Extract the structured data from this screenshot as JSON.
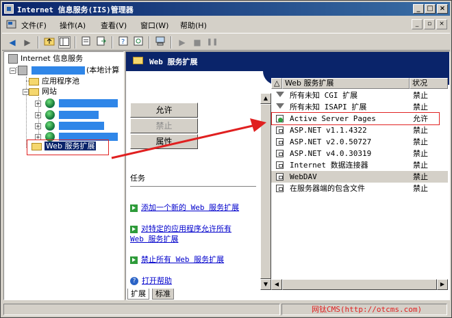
{
  "window": {
    "title": "Internet 信息服务(IIS)管理器",
    "minimize": "_",
    "maximize": "□",
    "close": "×"
  },
  "menu": {
    "items": [
      "文件(F)",
      "操作(A)",
      "查看(V)",
      "窗口(W)",
      "帮助(H)"
    ],
    "mdi": [
      "_",
      "▫",
      "×"
    ]
  },
  "toolbar": {
    "icons": [
      "back-icon",
      "forward-icon",
      "up-folder-icon",
      "show-tree-icon",
      "properties-icon",
      "export-icon",
      "help-icon",
      "refresh-icon",
      "computer-icon",
      "play-icon",
      "stop-icon",
      "pause-icon"
    ]
  },
  "tree": {
    "root": "Internet 信息服务",
    "computer_suffix": "(本地计算",
    "app_pools": "应用程序池",
    "sites": "网站",
    "site_fragment": "",
    "web_ext": "Web 服务扩展"
  },
  "header": {
    "title": "Web 服务扩展"
  },
  "buttons": {
    "allow": "允许",
    "deny": "禁止",
    "properties": "属性"
  },
  "tasks": {
    "label": "任务",
    "add_new": "添加一个新的 Web 服务扩展",
    "allow_all_line1": "对特定的应用程序允许所有",
    "allow_all_line2": "Web 服务扩展",
    "deny_all": "禁止所有 Web 服务扩展",
    "open_help": "打开帮助"
  },
  "tabs": [
    "扩展",
    "标准"
  ],
  "list": {
    "columns": [
      "Web 服务扩展",
      "状况"
    ],
    "rows": [
      {
        "name": "所有未知 CGI 扩展",
        "status": "禁止",
        "icon": "filter-icon"
      },
      {
        "name": "所有未知 ISAPI 扩展",
        "status": "禁止",
        "icon": "filter-icon"
      },
      {
        "name": "Active Server Pages",
        "status": "允许",
        "icon": "allowed-extension-icon"
      },
      {
        "name": "ASP.NET v1.1.4322",
        "status": "禁止",
        "icon": "extension-icon"
      },
      {
        "name": "ASP.NET v2.0.50727",
        "status": "禁止",
        "icon": "extension-icon"
      },
      {
        "name": "ASP.NET v4.0.30319",
        "status": "禁止",
        "icon": "extension-icon"
      },
      {
        "name": "Internet 数据连接器",
        "status": "禁止",
        "icon": "extension-icon"
      },
      {
        "name": "WebDAV",
        "status": "禁止",
        "icon": "extension-icon"
      },
      {
        "name": "在服务器端的包含文件",
        "status": "禁止",
        "icon": "extension-icon"
      }
    ]
  },
  "watermark": "网钛CMS(http://otcms.com)",
  "colors": {
    "accent": "#0a246a",
    "annotation": "#e02020",
    "redacted": "#2f86e8"
  }
}
